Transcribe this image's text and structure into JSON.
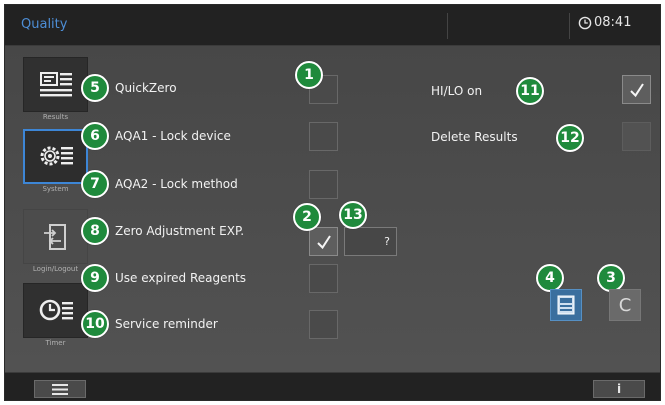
{
  "header": {
    "title": "Quality",
    "time": "08:41",
    "clock_icon": "clock-icon"
  },
  "sidebar": {
    "tabs": [
      {
        "label": "Results",
        "icon": "results-icon",
        "state": "inactive"
      },
      {
        "label": "System",
        "icon": "system-gear-icon",
        "state": "active"
      },
      {
        "label": "Login/Logout",
        "icon": "login-logout-icon",
        "state": "dimmed"
      },
      {
        "label": "Timer",
        "icon": "timer-icon",
        "state": "inactive"
      }
    ]
  },
  "settings_left": [
    {
      "badge": "5",
      "label": "QuickZero",
      "checked": false
    },
    {
      "badge": "6",
      "label": "AQA1 - Lock device",
      "checked": false
    },
    {
      "badge": "7",
      "label": "AQA2 - Lock method",
      "checked": false
    },
    {
      "badge": "8",
      "label": "Zero Adjustment EXP.",
      "checked": true
    },
    {
      "badge": "9",
      "label": "Use expired Reagents",
      "checked": false
    },
    {
      "badge": "10",
      "label": "Service reminder",
      "checked": false
    }
  ],
  "settings_right": [
    {
      "badge": "11",
      "label": "HI/LO on",
      "checked": true,
      "enabled": true
    },
    {
      "badge": "12",
      "label": "Delete Results",
      "checked": false,
      "enabled": false
    }
  ],
  "callouts": {
    "checkbox_column": "1",
    "zero_checkbox": "2",
    "clear_button": "3",
    "save_button": "4",
    "number_field": "13"
  },
  "number_field": {
    "value": "?"
  },
  "actions": {
    "clear_label": "C",
    "save_icon": "save-icon"
  },
  "footer": {
    "menu_icon": "menu-icon",
    "info_label": "i"
  },
  "colors": {
    "accent": "#3d86d6",
    "badge_green": "#1f8a3c",
    "title_blue": "#4d8ed6"
  }
}
